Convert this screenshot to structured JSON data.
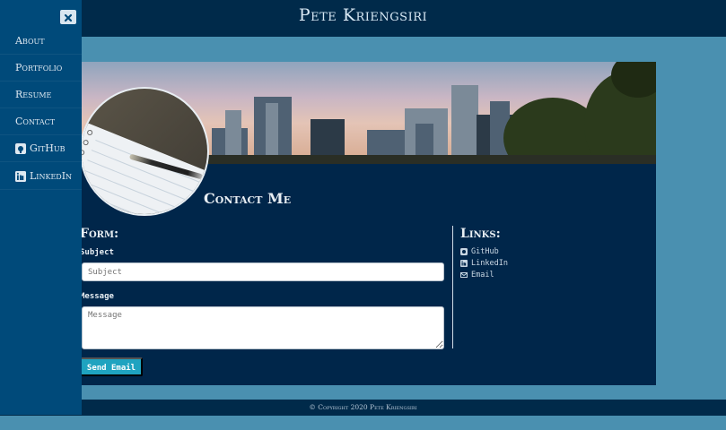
{
  "site": {
    "title": "Pete Kriengsiri"
  },
  "sidebar": {
    "items": [
      {
        "label": "About",
        "icon": ""
      },
      {
        "label": "Portfolio",
        "icon": ""
      },
      {
        "label": "Resume",
        "icon": ""
      },
      {
        "label": "Contact",
        "icon": ""
      },
      {
        "label": "GitHub",
        "icon": "github-icon"
      },
      {
        "label": "LinkedIn",
        "icon": "linkedin-icon"
      }
    ]
  },
  "contact": {
    "heading": "Contact Me",
    "form": {
      "title": "Form:",
      "subject_label": "Subject",
      "subject_placeholder": "Subject",
      "message_label": "Message",
      "message_placeholder": "Message",
      "send_label": "Send Email"
    },
    "links": {
      "title": "Links:",
      "items": [
        {
          "label": "GitHub",
          "icon": "github-icon"
        },
        {
          "label": "LinkedIn",
          "icon": "linkedin-icon"
        },
        {
          "label": "Email",
          "icon": "envelope-icon"
        }
      ]
    }
  },
  "footer": {
    "text": "© Copyright 2020 Pete Kriengsiri"
  },
  "colors": {
    "page_bg": "#4a90b0",
    "topbar": "#002a4a",
    "sidebar": "#004a7a",
    "card": "#00264a",
    "button": "#1fa3c0"
  }
}
